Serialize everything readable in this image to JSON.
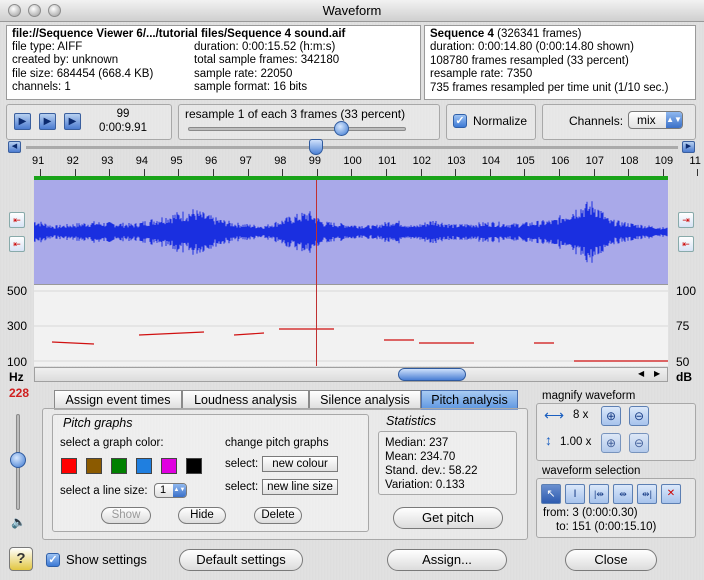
{
  "window": {
    "title": "Waveform"
  },
  "file_info": {
    "path": "file://Sequence Viewer 6/.../tutorial files/Sequence 4 sound.aif",
    "file_type": "file type: AIFF",
    "created_by": "created by: unknown",
    "file_size": "file size: 684454 (668.4 KB)",
    "channels": "channels: 1",
    "duration": "duration: 0:00:15.52 (h:m:s)",
    "total_frames": "total sample frames: 342180",
    "sample_rate": "sample rate: 22050",
    "sample_format": "sample format: 16 bits"
  },
  "sequence_info": {
    "name": "Sequence 4",
    "frames": " (326341 frames)",
    "duration": "duration: 0:00:14.80 (0:00:14.80 shown)",
    "resampled": "108780 frames resampled (33 percent)",
    "resample_rate": "resample rate: 7350",
    "per_unit": "735 frames resampled per time unit (1/10 sec.)"
  },
  "transport": {
    "frame": "99",
    "time": "0:00:9.91"
  },
  "resample": {
    "label": "resample 1 of each 3 frames (33 percent)",
    "percent": 33
  },
  "normalize": {
    "label": "Normalize",
    "checked": true
  },
  "channels": {
    "label": "Channels:",
    "value": "mix"
  },
  "ruler": {
    "ticks": [
      "91",
      "92",
      "93",
      "94",
      "95",
      "96",
      "97",
      "98",
      "99",
      "100",
      "101",
      "102",
      "103",
      "104",
      "105",
      "106",
      "107",
      "108",
      "109",
      "11"
    ]
  },
  "pitch_axis": {
    "left": [
      "500",
      "300",
      "100"
    ],
    "right": [
      "100",
      "75",
      "50"
    ],
    "left_unit": "Hz",
    "right_unit": "dB",
    "cursor_value": "228"
  },
  "tabs": [
    "Assign event times",
    "Loudness analysis",
    "Silence analysis",
    "Pitch analysis"
  ],
  "pitch_graphs": {
    "title": "Pitch graphs",
    "color_label": "select a graph color:",
    "colors": [
      "#ff0000",
      "#8b5a00",
      "#008000",
      "#1f7fe0",
      "#e000e0",
      "#000000"
    ],
    "line_size_label": "select a line size:",
    "line_size": "1",
    "change_label": "change pitch graphs",
    "select1": "select:",
    "new_colour": "new colour",
    "select2": "select:",
    "new_line_size": "new line size",
    "show": "Show",
    "hide": "Hide",
    "delete": "Delete"
  },
  "statistics": {
    "title": "Statistics",
    "median": "Median: 237",
    "mean": "Mean: 234.70",
    "stdev": "Stand. dev.: 58.22",
    "variation": "Variation: 0.133",
    "get_pitch": "Get pitch"
  },
  "magnify": {
    "title": "magnify waveform",
    "horizontal": "8 x",
    "vertical": "1.00 x"
  },
  "selection": {
    "title": "waveform selection",
    "from": "from: 3 (0:00:0.30)",
    "to": "to: 151 (0:00:15.10)"
  },
  "footer": {
    "help": "?",
    "show_settings": "Show settings",
    "default_settings": "Default settings",
    "assign": "Assign...",
    "close": "Close"
  }
}
